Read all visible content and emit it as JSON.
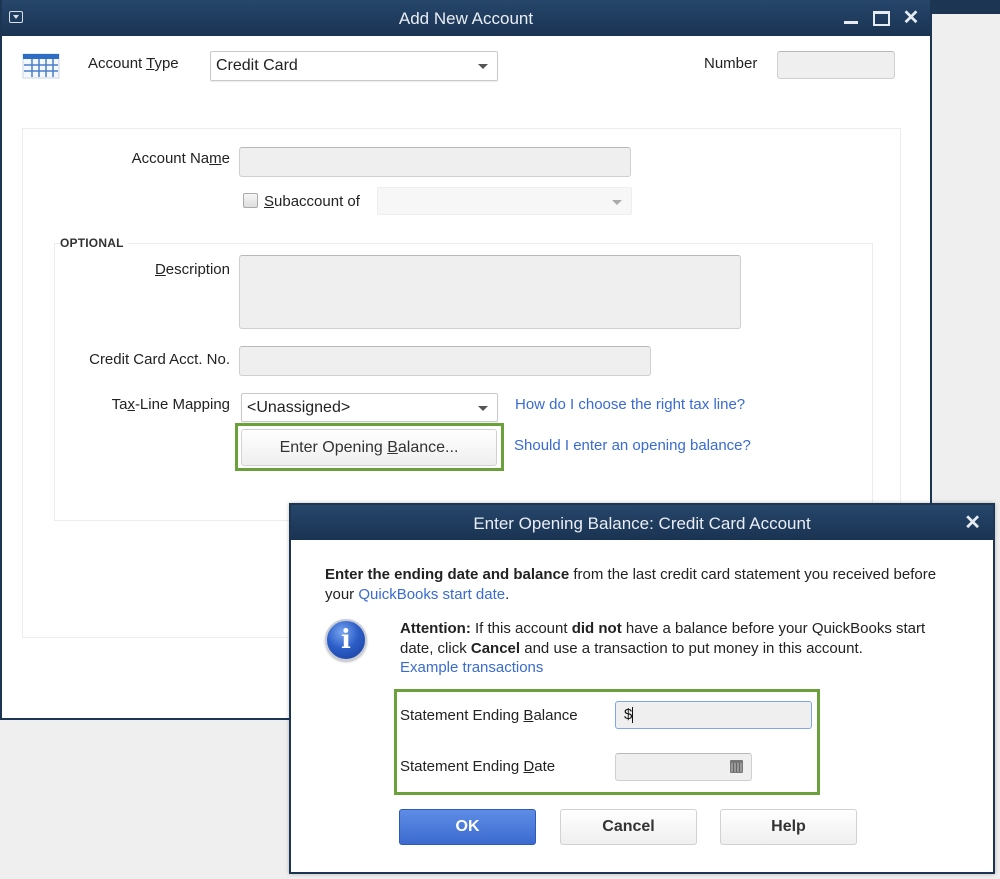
{
  "main_window": {
    "title": "Add New Account",
    "account_type_label_pre": "Account ",
    "account_type_label_u": "T",
    "account_type_label_post": "ype",
    "account_type_value": "Credit Card",
    "number_label": "Number",
    "number_value": "",
    "account_name_label_pre": "Account Na",
    "account_name_label_u": "m",
    "account_name_label_post": "e",
    "account_name_value": "",
    "subaccount_label_u": "S",
    "subaccount_label_post": "ubaccount of",
    "subaccount_checked": false,
    "subaccount_value": "",
    "optional_label": "OPTIONAL",
    "description_label_u": "D",
    "description_label_post": "escription",
    "description_value": "",
    "cc_acct_no_label": "Credit Card Acct. No.",
    "cc_acct_no_value": "",
    "tax_line_label_pre": "Ta",
    "tax_line_label_u": "x",
    "tax_line_label_post": "-Line Mapping",
    "tax_line_value": "<Unassigned>",
    "tax_line_help_link": "How do I choose the right tax line?",
    "opening_balance_button_pre": "Enter Opening ",
    "opening_balance_button_u": "B",
    "opening_balance_button_post": "alance...",
    "opening_balance_help_link": "Should I enter an opening balance?"
  },
  "dialog": {
    "title": "Enter Opening Balance: Credit Card Account",
    "intro_bold": "Enter the ending date and balance",
    "intro_rest": " from the last credit card statement you received before your ",
    "intro_link": "QuickBooks start date",
    "intro_end": ".",
    "attention_bold": "Attention:",
    "attention_1": " If this account ",
    "attention_bold2": "did not",
    "attention_2": " have a balance before your QuickBooks start date, click ",
    "attention_bold3": "Cancel",
    "attention_3": " and use a transaction to put money in this account.",
    "example_link": "Example transactions",
    "balance_label_pre": "Statement Ending ",
    "balance_label_u": "B",
    "balance_label_post": "alance",
    "balance_value": "$",
    "date_label_pre": "Statement Ending ",
    "date_label_u": "D",
    "date_label_post": "ate",
    "date_value": "",
    "ok_label": "OK",
    "cancel_label": "Cancel",
    "help_label": "Help"
  },
  "colors": {
    "titlebar": "#1b3553",
    "link": "#3a6bd0",
    "highlight": "#6aa13a",
    "ok_button": "#3c6bd0"
  }
}
